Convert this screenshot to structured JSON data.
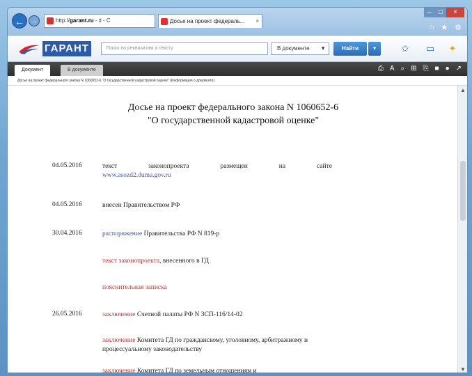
{
  "browser": {
    "address_domain": "garant.ru",
    "address_text": "garant.ru",
    "address_suffix": "- ♯ - C",
    "tab_title": "Досье на проект федераль...",
    "tab_close": "×",
    "window_controls": [
      "–",
      "□",
      "×"
    ],
    "toolbar_icons": [
      "⌂",
      "★",
      "⚙"
    ]
  },
  "garant": {
    "logo_text": "ГАРАНТ",
    "search_placeholder": "Поиск по реквизитам и тексту",
    "doc_select_value": "В документе",
    "find_label": "Найти",
    "toolbar_icons": [
      "star-doc-icon",
      "briefcase-icon",
      "lightbulb-icon"
    ]
  },
  "doc_tabs": {
    "active": "Документ",
    "other": "В документе"
  },
  "strip_icons": [
    "⎙",
    "A",
    "⌕",
    "⊞",
    "⎘",
    "■",
    "●",
    "↗"
  ],
  "breadcrumb": "Досье на проект федерального закона N 1060652-6 \"О государственной кадастровой оценке\" (Информация о документе)",
  "doc": {
    "title_line1": "Досье на проект федерального закона N 1060652-6",
    "title_line2": "\"О государственной кадастровой оценке\"",
    "entries": [
      {
        "date": "04.05.2016",
        "parts": [
          "текст",
          "законопроекта",
          "размещен",
          "на",
          "сайте"
        ],
        "extra": "www.asozd2.duma.gov.ru"
      },
      {
        "date": "04.05.2016",
        "text": "внесен Правительством РФ"
      },
      {
        "date": "30.04.2016",
        "link": "распоряжение",
        "text": " Правительства РФ N 819-р"
      },
      {
        "date": "",
        "link": "текст законопроекта",
        "text": ", внесенного в ГД"
      },
      {
        "date": "",
        "link": "пояснительная записка",
        "text": ""
      },
      {
        "date": "26.05.2016",
        "link": "заключение",
        "text": " Счетной палаты РФ N ЗСП-116/14-02"
      },
      {
        "date": "",
        "link": "заключение",
        "text": " Комитета ГД по гражданскому, уголовному, арбитражному и процессуальному законодательству"
      },
      {
        "date": "",
        "link": "заключение",
        "text": " Комитета ГД по земельным отношениям и"
      }
    ]
  }
}
